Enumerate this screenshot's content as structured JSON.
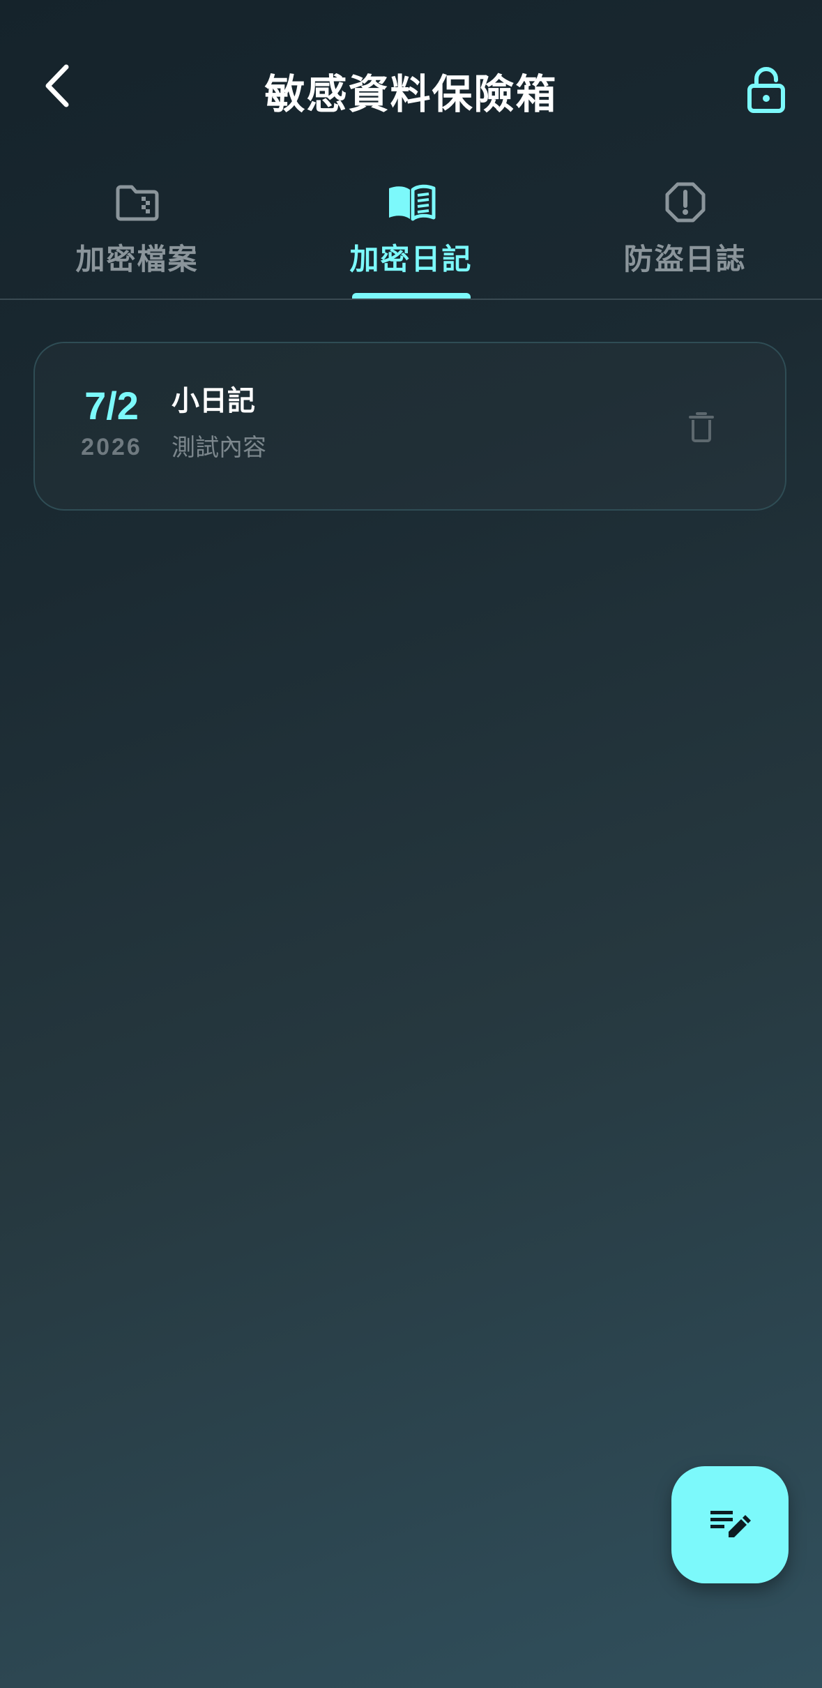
{
  "header": {
    "title": "敏感資料保險箱",
    "back_icon": "chevron-left-icon",
    "lock_icon": "unlocked-padlock-icon"
  },
  "tabs": [
    {
      "label": "加密檔案",
      "icon": "encrypted-folder-icon",
      "active": false
    },
    {
      "label": "加密日記",
      "icon": "open-book-icon",
      "active": true
    },
    {
      "label": "防盜日誌",
      "icon": "alert-octagon-icon",
      "active": false
    }
  ],
  "diary_entries": [
    {
      "date_day": "7/2",
      "date_year": "2026",
      "title": "小日記",
      "preview": "測試內容",
      "delete_icon": "trash-icon"
    }
  ],
  "fab": {
    "icon": "edit-note-icon"
  },
  "colors": {
    "accent": "#7cf9fb",
    "inactive": "#8b959b",
    "background_top": "#15232b",
    "background_bottom": "#31505d"
  }
}
